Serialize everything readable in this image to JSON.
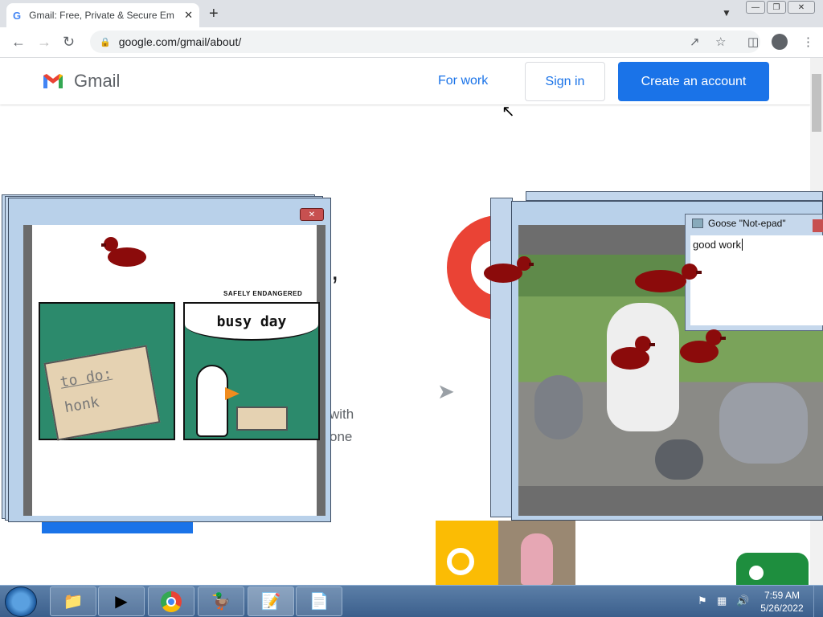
{
  "browser": {
    "tab_title": "Gmail: Free, Private & Secure Em",
    "tab_icon": "G",
    "url": "google.com/gmail/about/",
    "new_tab": "+",
    "close_tab": "✕"
  },
  "gmail": {
    "logo_text": "Gmail",
    "for_work": "For work",
    "sign_in": "Sign in",
    "create_account": "Create an account",
    "bg_comma": ",",
    "bg_with": "with",
    "bg_one": "one"
  },
  "comic": {
    "banner": "busy day",
    "safely": "SAFELY ENDANGERED",
    "scroll_line1": "to do:",
    "scroll_line2": "honk"
  },
  "notepad": {
    "title": "Goose \"Not-epad\"",
    "body": "good work"
  },
  "taskbar": {
    "time": "7:59 AM",
    "date": "5/26/2022",
    "apps": [
      "folder-icon",
      "media-icon",
      "chrome-icon",
      "goose-game-icon",
      "notepad-plus-icon",
      "notepad-icon"
    ]
  },
  "colors": {
    "accent": "#1a73e8",
    "duck": "#8b0b0b",
    "comic_green": "#2c8a6c"
  }
}
